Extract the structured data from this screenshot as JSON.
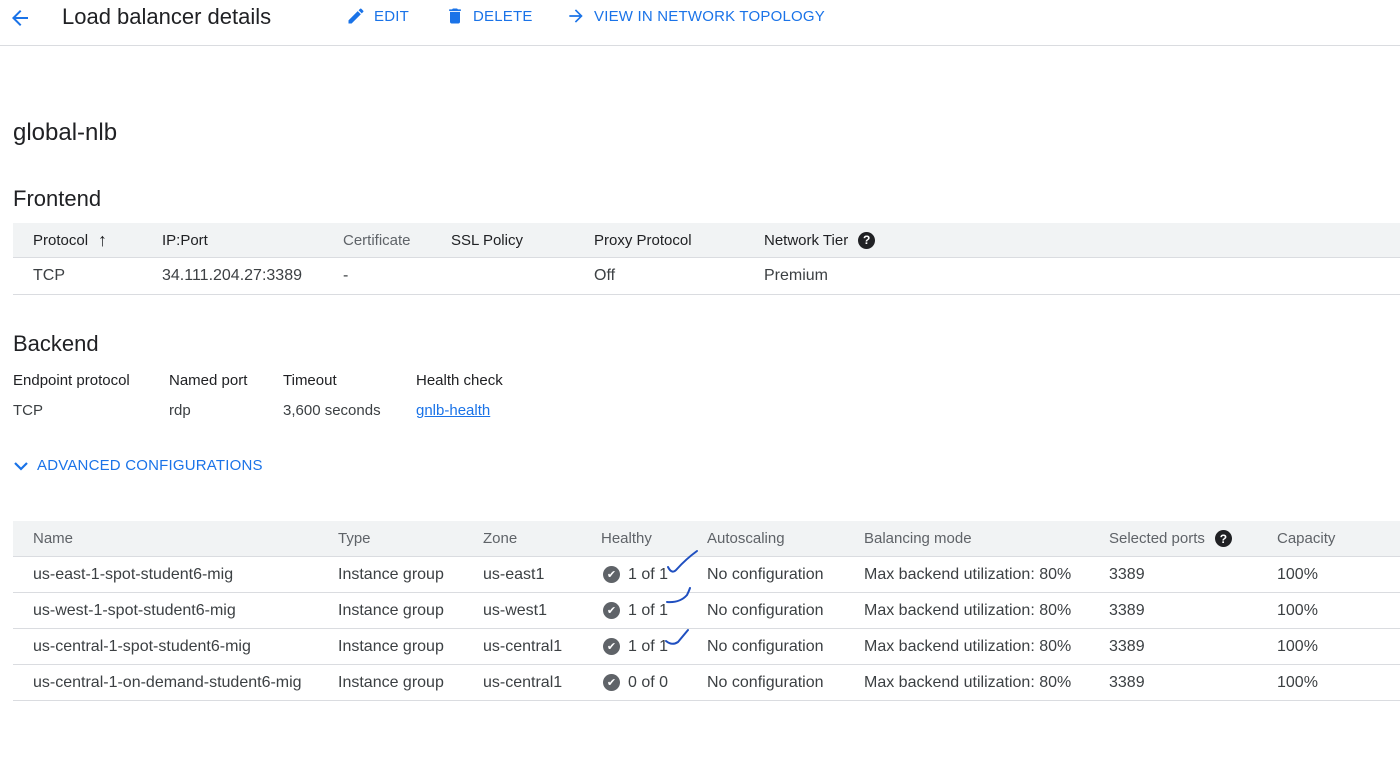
{
  "header": {
    "title": "Load balancer details",
    "actions": {
      "edit": "EDIT",
      "delete": "DELETE",
      "topology": "VIEW IN NETWORK TOPOLOGY"
    }
  },
  "lb_name": "global-nlb",
  "frontend": {
    "title": "Frontend",
    "columns": [
      "Protocol",
      "IP:Port",
      "Certificate",
      "SSL Policy",
      "Proxy Protocol",
      "Network Tier"
    ],
    "row": [
      "TCP",
      "34.111.204.27:3389",
      "-",
      "",
      "Off",
      "Premium"
    ]
  },
  "backend": {
    "title": "Backend",
    "labels": [
      "Endpoint protocol",
      "Named port",
      "Timeout",
      "Health check"
    ],
    "values": [
      "TCP",
      "rdp",
      "3,600 seconds",
      "gnlb-health"
    ]
  },
  "advanced": {
    "label": "ADVANCED CONFIGURATIONS"
  },
  "backends_table": {
    "columns": [
      "Name",
      "Type",
      "Zone",
      "Healthy",
      "Autoscaling",
      "Balancing mode",
      "Selected ports",
      "Capacity"
    ],
    "rows": [
      [
        "us-east-1-spot-student6-mig",
        "Instance group",
        "us-east1",
        "1 of 1",
        "No configuration",
        "Max backend utilization: 80%",
        "3389",
        "100%"
      ],
      [
        "us-west-1-spot-student6-mig",
        "Instance group",
        "us-west1",
        "1 of 1",
        "No configuration",
        "Max backend utilization: 80%",
        "3389",
        "100%"
      ],
      [
        "us-central-1-spot-student6-mig",
        "Instance group",
        "us-central1",
        "1 of 1",
        "No configuration",
        "Max backend utilization: 80%",
        "3389",
        "100%"
      ],
      [
        "us-central-1-on-demand-student6-mig",
        "Instance group",
        "us-central1",
        "0 of 0",
        "No configuration",
        "Max backend utilization: 80%",
        "3389",
        "100%"
      ]
    ]
  },
  "colors": {
    "accent": "#1a73e8",
    "handwriting": "#1f4fc0"
  }
}
